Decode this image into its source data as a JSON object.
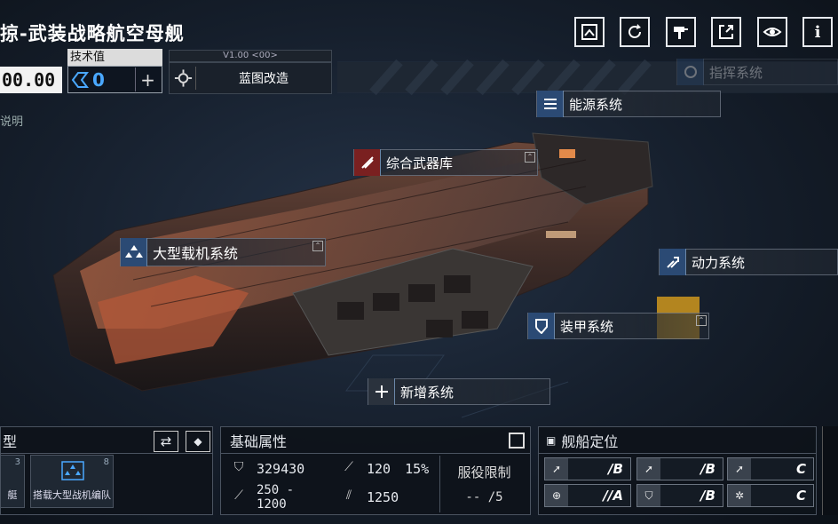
{
  "title": "掠-武装战略航空母舰",
  "cost": {
    "value": "00.00"
  },
  "tech": {
    "label": "技术值",
    "value": "0",
    "plus": "+"
  },
  "blueprint": {
    "version": "V1.00 <00>",
    "label": "蓝图改造"
  },
  "description_stub": "说明",
  "top_buttons": [
    {
      "icon": "blueprint-icon"
    },
    {
      "icon": "refresh-icon"
    },
    {
      "icon": "paint-icon"
    },
    {
      "icon": "share-icon"
    },
    {
      "icon": "view-icon"
    },
    {
      "icon": "info-icon",
      "glyph": "i"
    }
  ],
  "systems": {
    "command": "指挥系统",
    "energy": "能源系统",
    "weapons": "综合武器库",
    "carrier": "大型载机系统",
    "power": "动力系统",
    "armor": "装甲系统",
    "new": "新增系统"
  },
  "colors": {
    "accent_blue": "#2b4a74",
    "highlight_orange": "#c4901e",
    "tech_blue": "#4aa8ff"
  },
  "type_panel": {
    "title": "型",
    "swap_glyph": "⇄",
    "cards": [
      {
        "num": "3",
        "label": "艇"
      },
      {
        "num": "8",
        "label": "搭载大型战机编队"
      }
    ]
  },
  "attributes": {
    "title": "基础属性",
    "hp": "329430",
    "armor": "120",
    "armor_pct": "15%",
    "damage": "250 - 1200",
    "speed": "1250",
    "limit_title": "服役限制",
    "limit_value": "--  /5"
  },
  "positioning": {
    "title": "舰船定位",
    "cells": [
      {
        "value": "/B"
      },
      {
        "value": "/B"
      },
      {
        "value": "C"
      },
      {
        "value": "//A"
      },
      {
        "value": "/B"
      },
      {
        "value": "C"
      }
    ]
  }
}
